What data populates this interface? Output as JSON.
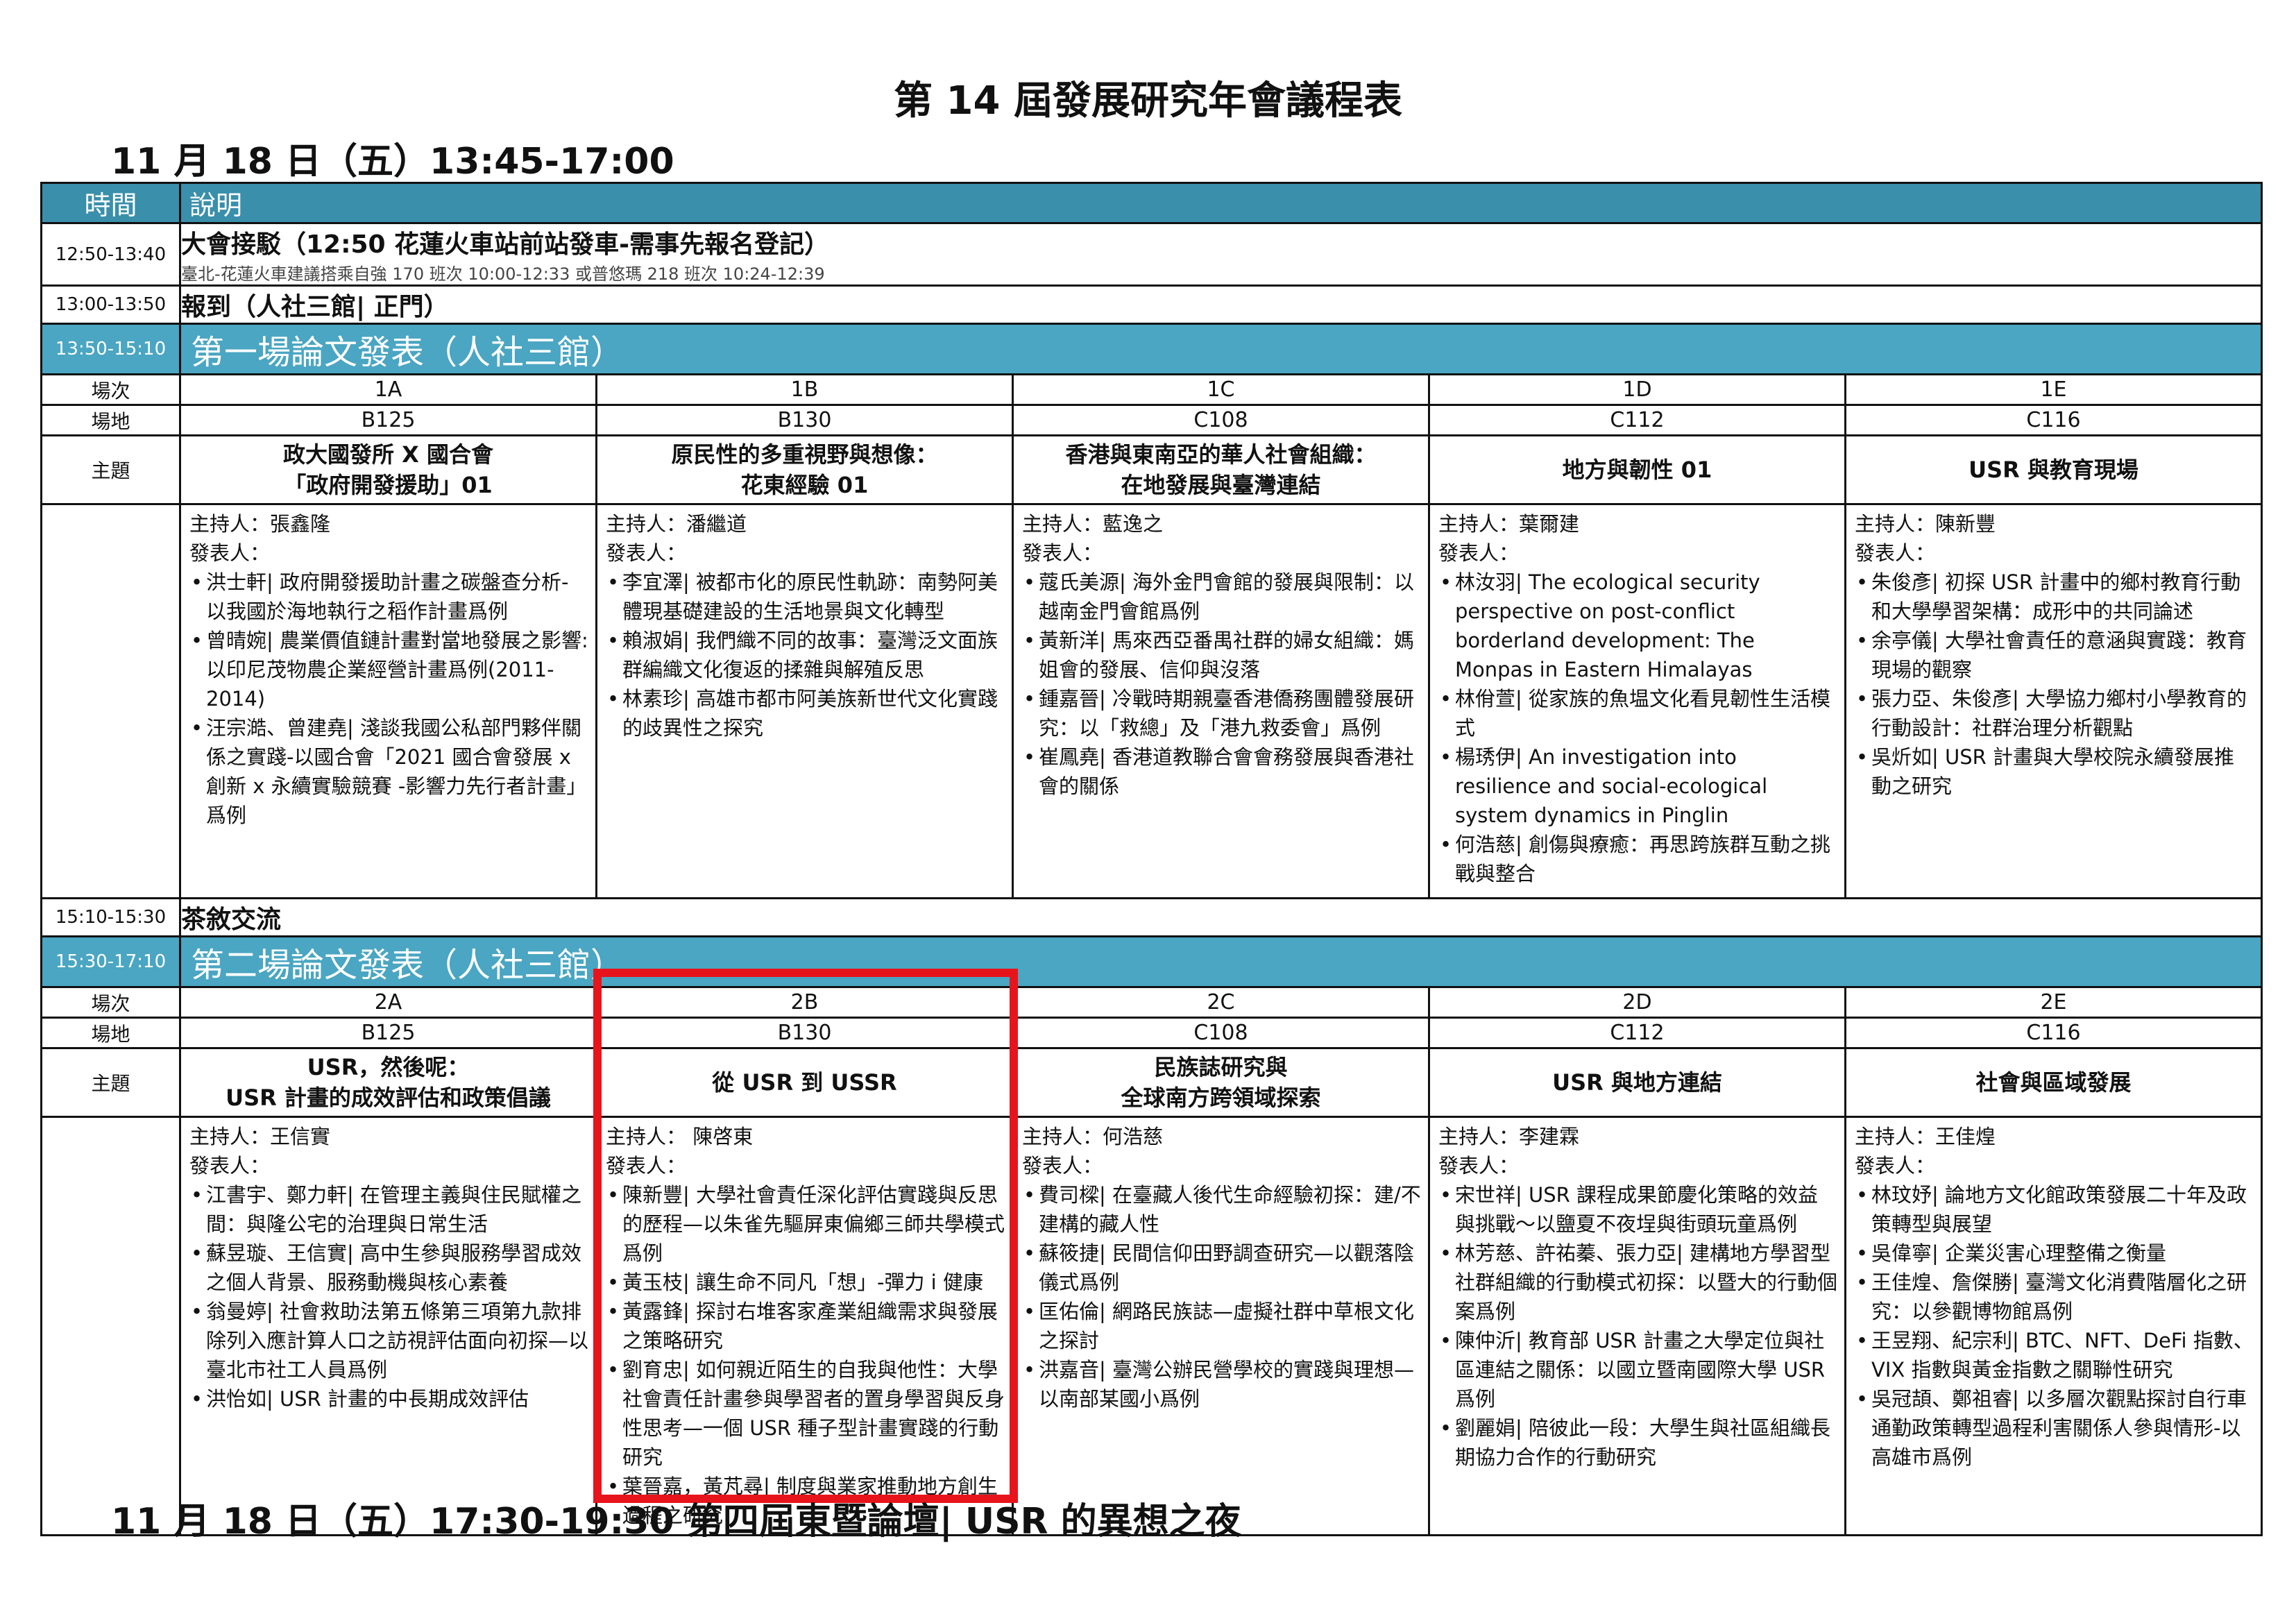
{
  "title": "第 14 屆發展研究年會議程表",
  "date_heading_1": "11 月 18 日（五）13:45-17:00",
  "date_heading_2": "11 月 18 日（五）17:30-19:30 第四屆東暨論壇| USR 的異想之夜",
  "colors": {
    "header": "#3a8fab",
    "band": "#4aa6c2",
    "highlight": "#e8141c"
  },
  "table": {
    "header": {
      "time": "時間",
      "desc": "說明"
    },
    "shuttle": {
      "time": "12:50-13:40",
      "title": "大會接駁（12:50 花蓮火車站前站發車-需事先報名登記）",
      "note": "臺北-花蓮火車建議搭乘自強 170 班次 10:00-12:33 或普悠瑪 218 班次 10:24-12:39"
    },
    "checkin": {
      "time": "13:00-13:50",
      "title": "報到（人社三館| 正門）"
    },
    "tea": {
      "time": "15:10-15:30",
      "title": "茶敘交流"
    },
    "labels": {
      "session": "場次",
      "venue": "場地",
      "topic": "主題"
    }
  },
  "session1": {
    "time": "13:50-15:10",
    "title": "第一場論文發表（人社三館）",
    "ids": [
      "1A",
      "1B",
      "1C",
      "1D",
      "1E"
    ],
    "rooms": [
      "B125",
      "B130",
      "C108",
      "C112",
      "C116"
    ],
    "topics": [
      [
        "政大國發所 X 國合會",
        "「政府開發援助」01"
      ],
      [
        "原民性的多重視野與想像：",
        "花東經驗 01"
      ],
      [
        "香港與東南亞的華人社會組織：",
        "在地發展與臺灣連結"
      ],
      [
        "地方與韌性 01"
      ],
      [
        "USR 與教育現場"
      ]
    ],
    "content": [
      {
        "host": "主持人：張鑫隆",
        "presenter_label": "發表人：",
        "presenters": [
          "洪士軒| 政府開發援助計畫之碳盤查分析-以我國於海地執行之稻作計畫爲例",
          "曾晴婉| 農業價值鏈計畫對當地發展之影響:以印尼茂物農企業經營計畫爲例(2011-2014)",
          "汪宗澔、曾建堯| 淺談我國公私部門夥伴關係之實踐-以國合會「2021 國合會發展 x 創新 x 永續實驗競賽 -影響力先行者計畫」爲例"
        ]
      },
      {
        "host": "主持人：潘繼道",
        "presenter_label": "發表人：",
        "presenters": [
          "李宜澤| 被都市化的原民性軌跡：南勢阿美體現基礎建設的生活地景與文化轉型",
          "賴淑娟| 我們織不同的故事：臺灣泛文面族群編織文化復返的揉雜與解殖反思",
          "林素珍| 高雄市都市阿美族新世代文化實踐的歧異性之探究"
        ]
      },
      {
        "host": "主持人：藍逸之",
        "presenter_label": "發表人：",
        "presenters": [
          "蔻氏美源| 海外金門會館的發展與限制：以越南金門會館爲例",
          "黃新洋| 馬來西亞番禺社群的婦女組織：媽姐會的發展、信仰與沒落",
          "鍾嘉晉| 冷戰時期親臺香港僑務團體發展研究：以「救總」及「港九救委會」爲例",
          "崔鳳堯| 香港道教聯合會會務發展與香港社會的關係"
        ]
      },
      {
        "host": "主持人：葉爾建",
        "presenter_label": "發表人：",
        "presenters": [
          "林汝羽| The ecological security perspective on post-conflict borderland development: The Monpas in Eastern Himalayas",
          "林佾萱| 從家族的魚塭文化看見韌性生活模式",
          "楊琇伊| An investigation into resilience and social-ecological system dynamics in Pinglin",
          "何浩慈| 創傷與療癒：再思跨族群互動之挑戰與整合"
        ]
      },
      {
        "host": "主持人：陳新豐",
        "presenter_label": "發表人：",
        "presenters": [
          "朱俊彥| 初探 USR 計畫中的鄉村教育行動和大學學習架構：成形中的共同論述",
          "余亭儀| 大學社會責任的意涵與實踐：教育現場的觀察",
          "張力亞、朱俊彥| 大學協力鄉村小學教育的行動設計：社群治理分析觀點",
          "吳炘如| USR 計畫與大學校院永續發展推動之研究"
        ]
      }
    ]
  },
  "session2": {
    "time": "15:30-17:10",
    "title": "第二場論文發表（人社三館）",
    "ids": [
      "2A",
      "2B",
      "2C",
      "2D",
      "2E"
    ],
    "rooms": [
      "B125",
      "B130",
      "C108",
      "C112",
      "C116"
    ],
    "topics": [
      [
        "USR，然後呢：",
        "USR 計畫的成效評估和政策倡議"
      ],
      [
        "從 USR 到 USSR"
      ],
      [
        "民族誌研究與",
        "全球南方跨領域探索"
      ],
      [
        "USR 與地方連結"
      ],
      [
        "社會與區域發展"
      ]
    ],
    "content": [
      {
        "host": "主持人：王信實",
        "presenter_label": "發表人：",
        "presenters": [
          "江書宇、鄭力軒| 在管理主義與住民賦權之間：與隆公宅的治理與日常生活",
          "蘇昱璇、王信實| 高中生參與服務學習成效之個人背景、服務動機與核心素養",
          "翁曼婷| 社會救助法第五條第三項第九款排除列入應計算人口之訪視評估面向初探—以臺北市社工人員爲例",
          "洪怡如| USR 計畫的中長期成效評估"
        ]
      },
      {
        "host": "主持人： 陳啓東",
        "presenter_label": "發表人：",
        "presenters": [
          "陳新豐| 大學社會責任深化評估實踐與反思的歷程—以朱雀先驅屏東偏鄉三師共學模式爲例",
          "黃玉枝| 讓生命不同凡「想」-彈力 i 健康",
          "黃露鋒| 探討右堆客家產業組織需求與發展之策略研究",
          "劉育忠| 如何親近陌生的自我與他性：大學社會責任計畫參與學習者的置身學習與反身性思考—一個 USR 種子型計畫實踐的行動研究",
          "葉晉嘉，黃芃尋| 制度與業家推動地方創生過程之研究"
        ]
      },
      {
        "host": "主持人：何浩慈",
        "presenter_label": "發表人：",
        "presenters": [
          "費司樑| 在臺藏人後代生命經驗初探：建/不建構的藏人性",
          "蘇筱捷| 民間信仰田野調查研究—以觀落陰儀式爲例",
          "匡佑倫| 網路民族誌—虛擬社群中草根文化之探討",
          "洪嘉音| 臺灣公辦民營學校的實踐與理想—以南部某國小爲例"
        ]
      },
      {
        "host": "主持人：李建霖",
        "presenter_label": "發表人：",
        "presenters": [
          "宋世祥| USR 課程成果節慶化策略的效益與挑戰～以鹽夏不夜埕與街頭玩童爲例",
          "林芳慈、許祐蓁、張力亞| 建構地方學習型社群組織的行動模式初探：以暨大的行動個案爲例",
          "陳仲沂| 教育部 USR 計畫之大學定位與社區連結之關係：以國立暨南國際大學 USR 爲例",
          "劉麗娟| 陪彼此一段：大學生與社區組織長期協力合作的行動研究"
        ]
      },
      {
        "host": "主持人：王佳煌",
        "presenter_label": "發表人：",
        "presenters": [
          "林玟妤| 論地方文化館政策發展二十年及政策轉型與展望",
          "吳偉寧| 企業災害心理整備之衡量",
          "王佳煌、詹傑勝| 臺灣文化消費階層化之研究：以參觀博物館爲例",
          "王昱翔、紀宗利| BTC、NFT、DeFi 指數、VIX 指數與黃金指數之關聯性研究",
          "吳冠頡、鄭祖睿| 以多層次觀點探討自行車通勤政策轉型過程利害關係人參與情形-以高雄市爲例"
        ]
      }
    ]
  }
}
